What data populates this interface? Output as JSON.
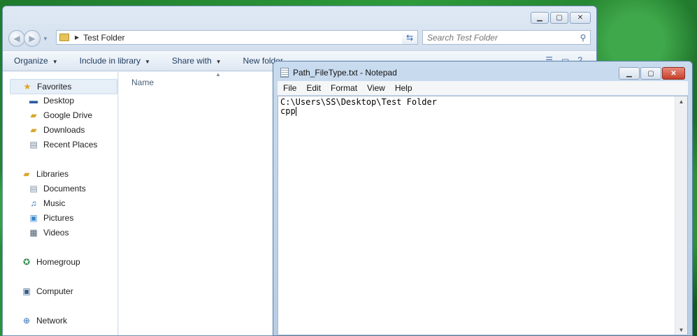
{
  "explorer": {
    "breadcrumb": "Test Folder",
    "search_placeholder": "Search Test Folder",
    "toolbar": {
      "organize": "Organize",
      "include_in_library": "Include in library",
      "share_with": "Share with",
      "new_folder": "New folder"
    },
    "column_header": "Name",
    "nav": {
      "favorites": "Favorites",
      "favorites_items": [
        "Desktop",
        "Google Drive",
        "Downloads",
        "Recent Places"
      ],
      "libraries": "Libraries",
      "libraries_items": [
        "Documents",
        "Music",
        "Pictures",
        "Videos"
      ],
      "homegroup": "Homegroup",
      "computer": "Computer",
      "network": "Network"
    }
  },
  "notepad": {
    "title": "Path_FileType.txt - Notepad",
    "menu": [
      "File",
      "Edit",
      "Format",
      "View",
      "Help"
    ],
    "lines": [
      "C:\\Users\\SS\\Desktop\\Test Folder",
      "cpp"
    ]
  }
}
